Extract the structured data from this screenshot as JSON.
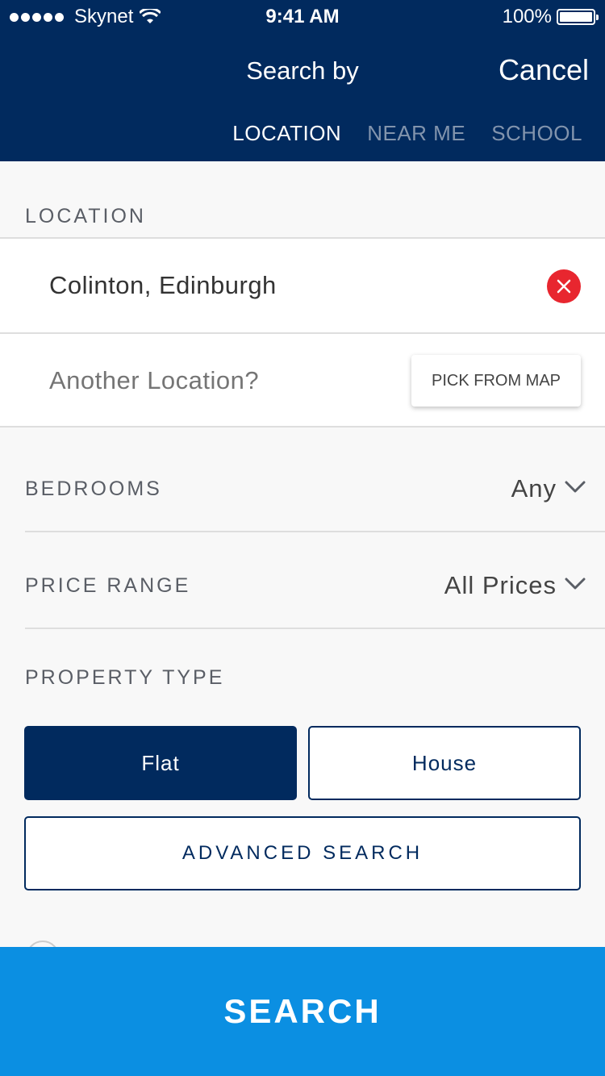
{
  "status_bar": {
    "carrier": "Skynet",
    "time": "9:41 AM",
    "battery": "100%"
  },
  "nav": {
    "title": "Search by",
    "cancel_label": "Cancel",
    "tabs": [
      {
        "label": "LOCATION",
        "active": true
      },
      {
        "label": "NEAR ME",
        "active": false
      },
      {
        "label": "SCHOOL",
        "active": false
      }
    ]
  },
  "location": {
    "section_label": "LOCATION",
    "value": "Colinton, Edinburgh",
    "another_placeholder": "Another Location?",
    "pick_map_label": "PICK FROM MAP"
  },
  "bedrooms": {
    "label": "BEDROOMS",
    "value": "Any"
  },
  "price_range": {
    "label": "PRICE RANGE",
    "value": "All Prices"
  },
  "property_type": {
    "label": "PROPERTY TYPE",
    "options": [
      {
        "label": "Flat",
        "selected": true
      },
      {
        "label": "House",
        "selected": false
      }
    ]
  },
  "advanced_label": "ADVANCED SEARCH",
  "search_label": "SEARCH",
  "colors": {
    "navy": "#012a5e",
    "blue": "#0b8fe2",
    "red": "#e8262f",
    "inactive_tab": "#8294ad"
  },
  "icons": [
    "wifi-icon",
    "battery-icon",
    "close-icon",
    "chevron-down-icon"
  ]
}
